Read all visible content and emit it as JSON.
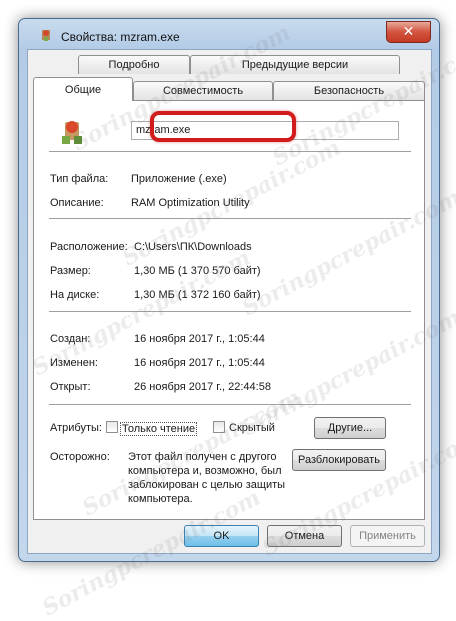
{
  "window": {
    "title": "Свойства: mzram.exe",
    "close_label": "✕"
  },
  "tabs": {
    "row_back": [
      {
        "label": "Подробно"
      },
      {
        "label": "Предыдущие версии"
      }
    ],
    "row_front": [
      {
        "label": "Общие"
      },
      {
        "label": "Совместимость"
      },
      {
        "label": "Безопасность"
      }
    ],
    "active": "Общие",
    "highlighted": "Совместимость"
  },
  "general": {
    "file_name": "mzram.exe",
    "file_type_label": "Тип файла:",
    "file_type_value": "Приложение (.exe)",
    "description_label": "Описание:",
    "description_value": "RAM Optimization Utility",
    "location_label": "Расположение:",
    "location_value": "C:\\Users\\ПК\\Downloads",
    "size_label": "Размер:",
    "size_value": "1,30 МБ (1 370 570 байт)",
    "disk_size_label": "На диске:",
    "disk_size_value": "1,30 МБ (1 372 160 байт)",
    "created_label": "Создан:",
    "created_value": "16 ноября 2017 г., 1:05:44",
    "modified_label": "Изменен:",
    "modified_value": "16 ноября 2017 г., 1:05:44",
    "accessed_label": "Открыт:",
    "accessed_value": "26 ноября 2017 г., 22:44:58",
    "attributes_label": "Атрибуты:",
    "readonly_label": "Только чтение",
    "hidden_label": "Скрытый",
    "other_button": "Другие...",
    "caution_label": "Осторожно:",
    "caution_text": [
      "Этот файл получен с другого",
      "компьютера и, возможно, был",
      "заблокирован с целью защиты",
      "компьютера."
    ],
    "unblock_button": "Разблокировать"
  },
  "footer": {
    "ok": "OK",
    "cancel": "Отмена",
    "apply": "Применить"
  },
  "watermark": "Soringpcrepair.com",
  "colors": {
    "highlight": "#d21c1c",
    "primary_button": "#98d1ef"
  }
}
